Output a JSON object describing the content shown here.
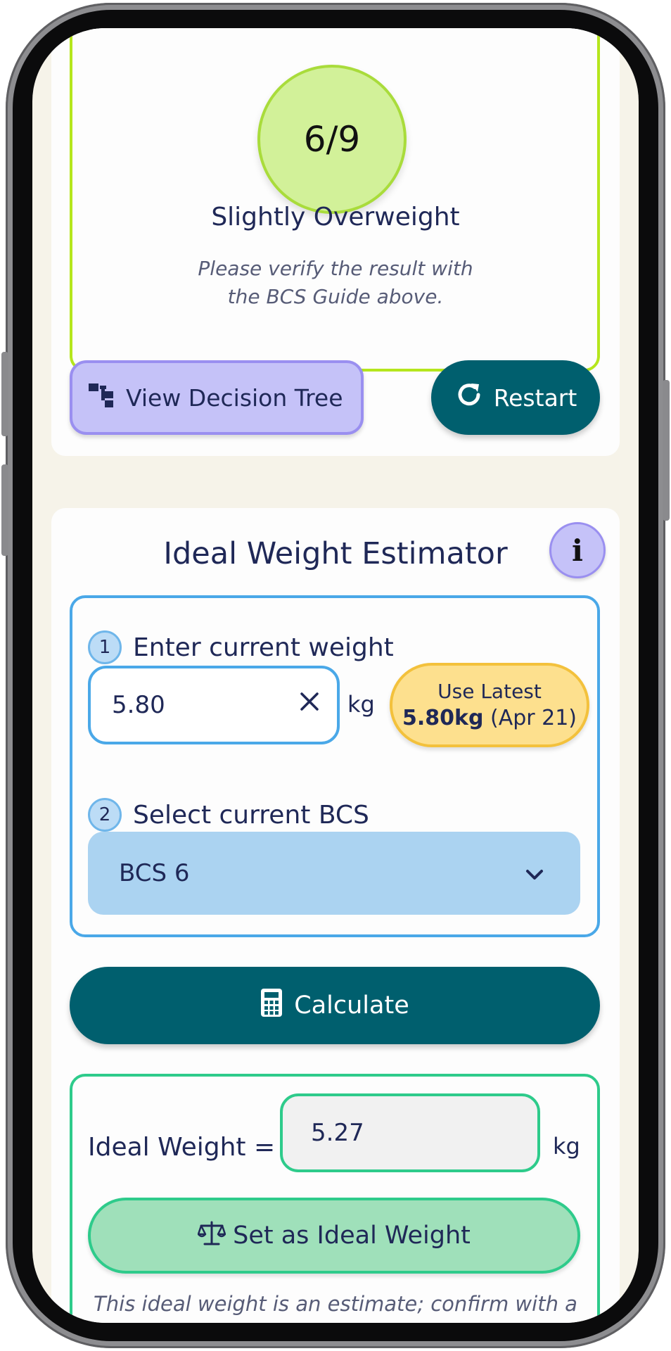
{
  "result": {
    "score": "6/9",
    "title": "Slightly Overweight",
    "note_line1": "Please verify the result with",
    "note_line2": "the BCS Guide above."
  },
  "actions": {
    "tree_label": "View Decision Tree",
    "restart_label": "Restart"
  },
  "estimator": {
    "title": "Ideal Weight Estimator",
    "info_icon": "i",
    "step1": {
      "num": "1",
      "label": "Enter current weight"
    },
    "weight_value": "5.80",
    "weight_unit": "kg",
    "use_latest": {
      "title": "Use Latest",
      "value": "5.80kg",
      "date": "(Apr 21)"
    },
    "step2": {
      "num": "2",
      "label": "Select current BCS"
    },
    "bcs_selected": "BCS 6",
    "calculate_label": "Calculate",
    "ideal_label": "Ideal Weight =",
    "ideal_value": "5.27",
    "ideal_unit": "kg",
    "set_ideal_label": "Set as Ideal Weight",
    "disclaimer": "This ideal weight is an estimate; confirm with a"
  },
  "colors": {
    "accent_teal": "#005f6e",
    "lime": "#b5e61d",
    "lavender": "#c5c2f8",
    "blue": "#4aa8e8",
    "green": "#2ecb8b",
    "yellow": "#fde08e"
  },
  "icons": [
    "tree-icon",
    "restart-icon",
    "info-icon",
    "clear-icon",
    "chevron-down-icon",
    "calculator-icon",
    "scale-icon"
  ]
}
